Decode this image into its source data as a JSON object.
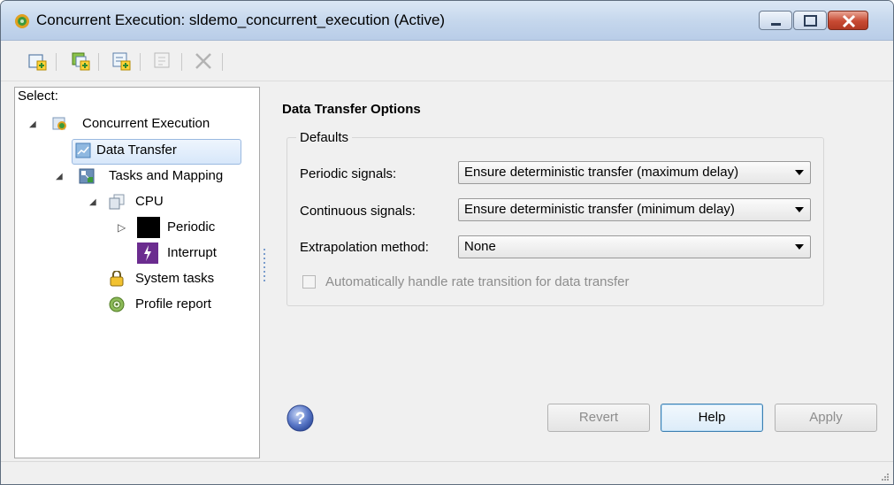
{
  "window": {
    "title": "Concurrent Execution: sldemo_concurrent_execution (Active)",
    "accent": "#c4d6ec"
  },
  "titlebar_buttons": {
    "minimize": "minimize-icon",
    "maximize": "maximize-icon",
    "close": "close-icon"
  },
  "toolbar": {
    "buttons": [
      {
        "icon": "add-task-icon",
        "enabled": true
      },
      {
        "icon": "add-trigger-icon",
        "enabled": true
      },
      {
        "icon": "add-periodic-icon",
        "enabled": true
      },
      {
        "icon": "add-mapping-icon",
        "enabled": false
      },
      {
        "icon": "delete-icon",
        "enabled": false
      }
    ]
  },
  "left_pane": {
    "select_label": "Select:",
    "tree": [
      {
        "label": "Concurrent Execution",
        "icon": "concurrent-execution-icon",
        "expanded": true
      },
      {
        "label": "Data Transfer",
        "icon": "data-transfer-icon",
        "selected": true
      },
      {
        "label": "Tasks and Mapping",
        "icon": "tasks-mapping-icon",
        "expanded": true
      },
      {
        "label": "CPU",
        "icon": "cpu-icon",
        "expanded": true
      },
      {
        "label": "Periodic",
        "icon": "periodic-icon",
        "expanded": false
      },
      {
        "label": "Interrupt",
        "icon": "interrupt-icon"
      },
      {
        "label": "System tasks",
        "icon": "system-tasks-icon"
      },
      {
        "label": "Profile report",
        "icon": "profile-report-icon"
      }
    ]
  },
  "main": {
    "heading": "Data Transfer Options",
    "group_label": "Defaults",
    "fields": [
      {
        "label": "Periodic signals:",
        "value": "Ensure deterministic transfer (maximum delay)"
      },
      {
        "label": "Continuous signals:",
        "value": "Ensure deterministic transfer (minimum delay)"
      },
      {
        "label": "Extrapolation method:",
        "value": "None"
      }
    ],
    "checkbox": {
      "label": "Automatically handle rate transition for data transfer",
      "checked": false,
      "enabled": false
    }
  },
  "buttons": {
    "revert": "Revert",
    "help": "Help",
    "apply": "Apply"
  }
}
